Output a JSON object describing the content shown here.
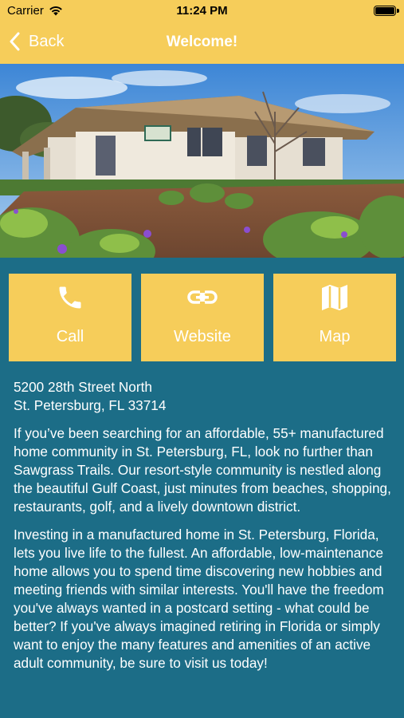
{
  "status": {
    "carrier": "Carrier",
    "time": "11:24 PM"
  },
  "nav": {
    "back_label": "Back",
    "title": "Welcome!"
  },
  "actions": [
    {
      "label": "Call",
      "icon": "phone-icon"
    },
    {
      "label": "Website",
      "icon": "link-icon"
    },
    {
      "label": "Map",
      "icon": "map-icon"
    }
  ],
  "address": {
    "line1": "5200 28th Street North",
    "line2": "St. Petersburg, FL 33714"
  },
  "paragraphs": [
    "If you’ve been searching for an affordable, 55+ manufactured home community in St. Petersburg, FL, look no further than Sawgrass Trails. Our resort-style community is nestled along the beautiful Gulf Coast, just minutes from beaches, shopping, restaurants, golf, and a lively downtown district.",
    "Investing in a manufactured home in St. Petersburg, Florida, lets you live life to the fullest. An affordable, low-maintenance home allows you to spend time discovering new hobbies and meeting friends with similar interests. You'll have the freedom you've always wanted in a postcard setting - what could be better? If you've always imagined retiring in Florida or simply want to enjoy the many features and amenities of an active adult community, be sure to visit us today!"
  ],
  "colors": {
    "accent": "#f6cd5a",
    "background": "#1c6d87",
    "text": "#ffffff"
  }
}
